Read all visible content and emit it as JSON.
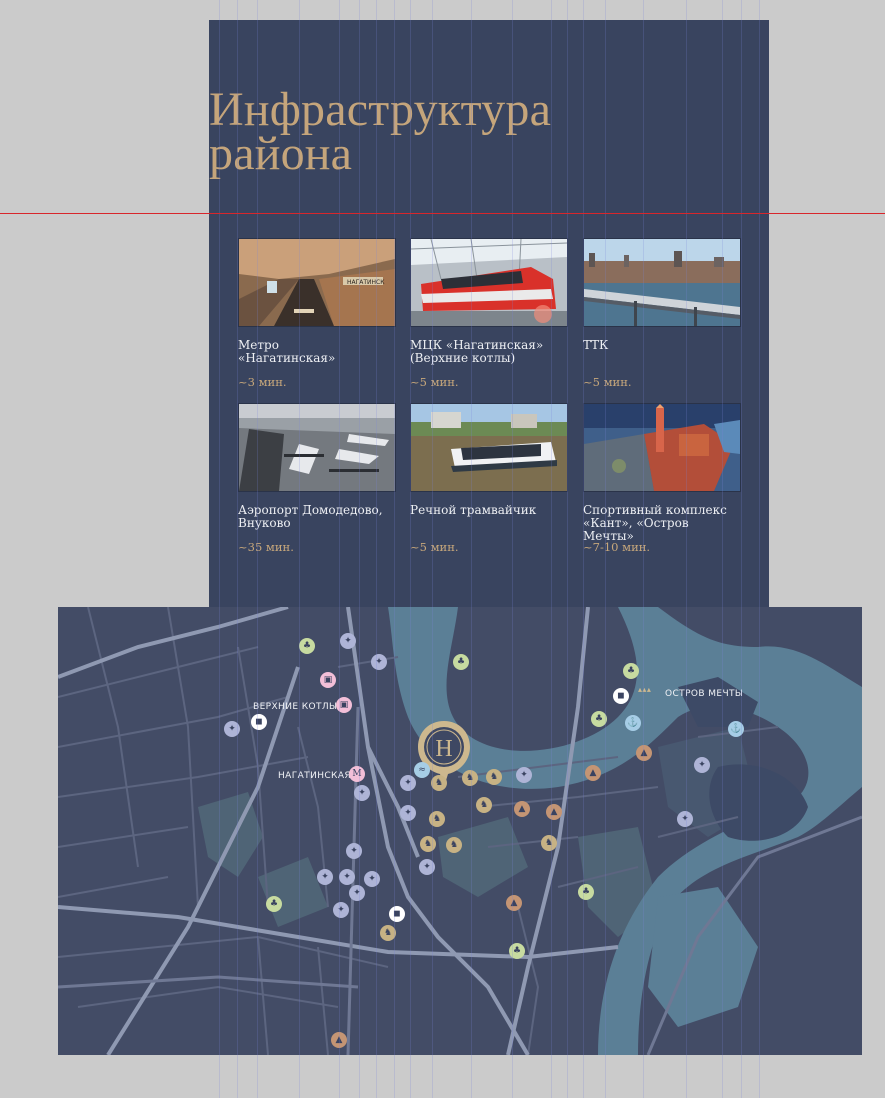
{
  "page": {
    "title": "Инфраструктура района"
  },
  "title_lines": [
    "Инфраструктура",
    "района"
  ],
  "cards": [
    {
      "label_lines": [
        "Метро",
        "«Нагатинская»"
      ],
      "time": "~3 мин.",
      "image": "metro-station-photo"
    },
    {
      "label_lines": [
        "МЦК «Нагатинская»",
        "(Верхние котлы)"
      ],
      "time": "~5 мин.",
      "image": "red-train-photo"
    },
    {
      "label_lines": [
        "ТТК",
        ""
      ],
      "time": "~5 мин.",
      "image": "city-bridge-photo"
    },
    {
      "label_lines": [
        "Аэропорт Домодедово,",
        "Внуково"
      ],
      "time": "~35 мин.",
      "image": "airport-photo"
    },
    {
      "label_lines": [
        "Речной трамвайчик",
        ""
      ],
      "time": "~5 мин.",
      "image": "river-boat-photo"
    },
    {
      "label_lines": [
        "Спортивный комплекс",
        "«Кант», «Остров Мечты»"
      ],
      "time": "~7-10 мин.",
      "image": "sport-complex-photo"
    }
  ],
  "map": {
    "labels": {
      "verkhnie_kotly": "ВЕРХНИЕ КОТЛЫ",
      "nagatinskaya": "НАГАТИНСКАЯ",
      "ostrov_mechty": "ОСТРОВ МЕЧТЫ"
    },
    "legend_icons": [
      "sport-icon",
      "park-icon",
      "education-icon",
      "kindergarten-icon",
      "shop-icon",
      "metro-icon",
      "train-icon",
      "anchor-icon",
      "river-icon",
      "logo-icon"
    ],
    "colors": {
      "background": "#434c66",
      "water": "#5b7f96",
      "park": "#4f6a78",
      "roads": "#6f7894",
      "main_roads": "#8f99b2"
    }
  },
  "colors": {
    "panel": "#39445f",
    "title": "#c5a57b",
    "time": "#c7a77b",
    "guide_line": "#d8262b"
  }
}
